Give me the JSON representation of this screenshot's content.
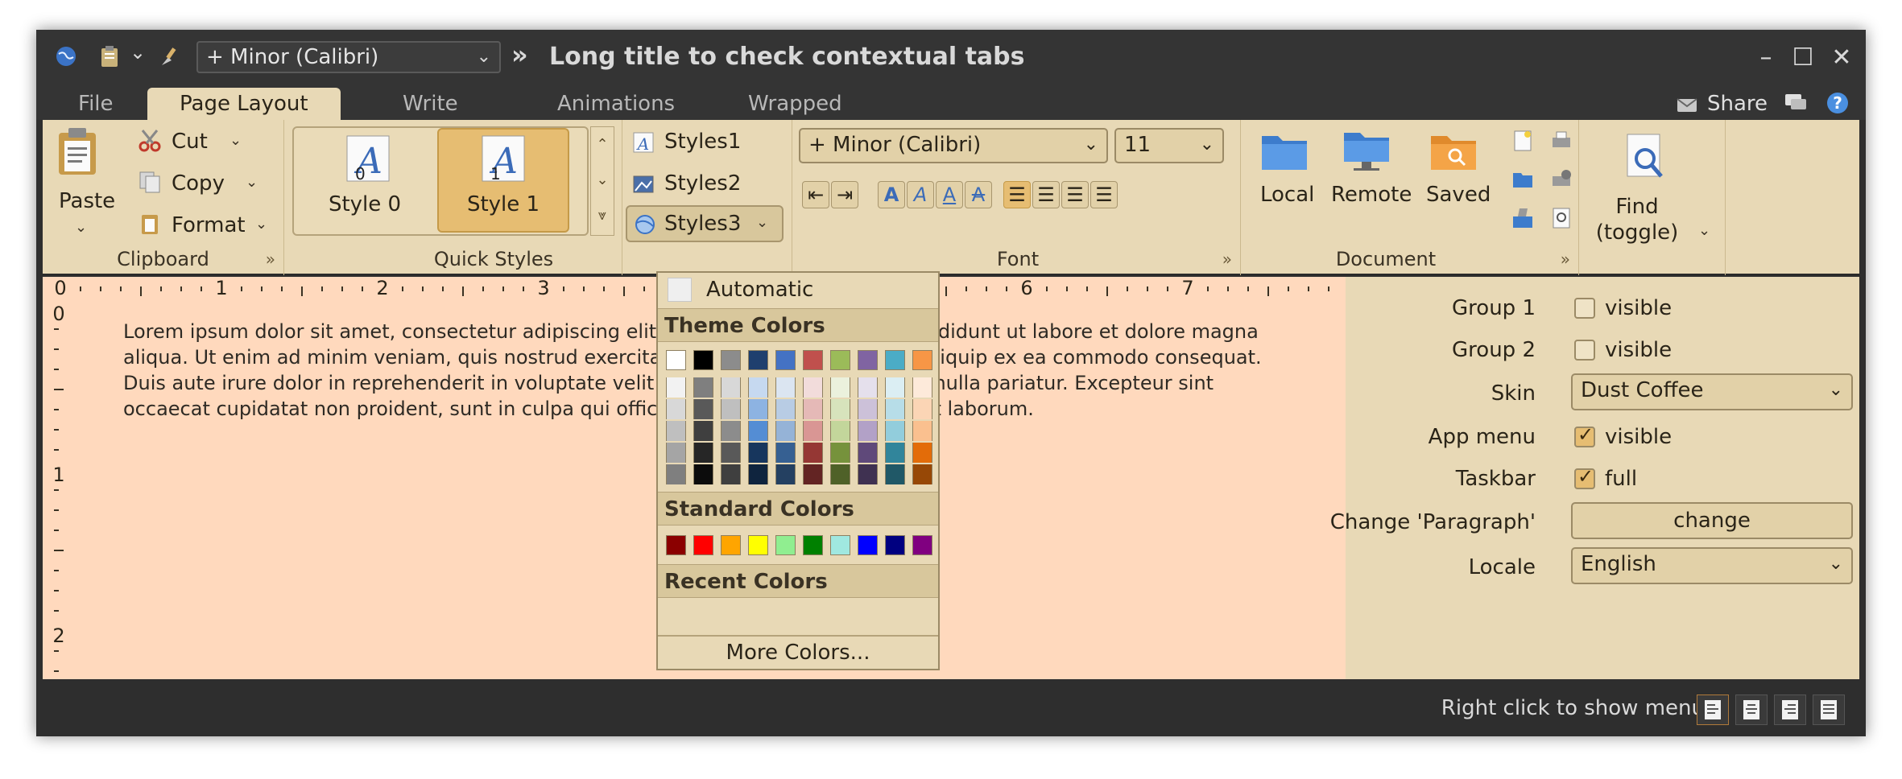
{
  "window": {
    "title": "Long title to check contextual tabs",
    "font_combo": "+ Minor (Calibri)",
    "overflow": "»"
  },
  "tabs": [
    {
      "label": "File"
    },
    {
      "label": "Page Layout"
    },
    {
      "label": "Write"
    },
    {
      "label": "Animations"
    },
    {
      "label": "Wrapped"
    }
  ],
  "share_label": "Share",
  "clipboard": {
    "paste": "Paste",
    "cut": "Cut",
    "copy": "Copy",
    "format": "Format",
    "title": "Clipboard"
  },
  "quick_styles": {
    "style0": "Style 0",
    "style1": "Style 1",
    "title": "Quick Styles"
  },
  "styles": {
    "styles1": "Styles1",
    "styles2": "Styles2",
    "styles3": "Styles3"
  },
  "font": {
    "family": "+ Minor (Calibri)",
    "size": "11",
    "title": "Font"
  },
  "document": {
    "local": "Local",
    "remote": "Remote",
    "saved": "Saved",
    "title": "Document"
  },
  "find": {
    "line1": "Find",
    "line2": "(toggle)"
  },
  "ruler": {
    "h_labels": [
      "0",
      "1",
      "2",
      "3",
      "4",
      "5",
      "6",
      "7"
    ],
    "v_labels": [
      "0",
      "1",
      "2"
    ]
  },
  "lorem": "Lorem ipsum dolor sit amet, consectetur adipiscing elit, sed do eiusmod tempor incididunt ut labore et dolore magna aliqua. Ut enim ad minim veniam, quis nostrud exercitation ullamco laboris nisi ut aliquip ex ea commodo consequat. Duis aute irure dolor in reprehenderit in voluptate velit esse cillum dolore eu fugiat nulla pariatur. Excepteur sint occaecat cupidatat non proident, sunt in culpa qui officia deserunt mollit anim id est laborum.",
  "color_popup": {
    "automatic": "Automatic",
    "theme_title": "Theme Colors",
    "standard_title": "Standard Colors",
    "recent_title": "Recent Colors",
    "more": "More Colors...",
    "theme_top": [
      "#ffffff",
      "#000000",
      "#8c8c8c",
      "#1f3f6e",
      "#4472c4",
      "#c0504d",
      "#9bbb59",
      "#8064a2",
      "#4bacc6",
      "#f79646"
    ],
    "theme_columns": [
      [
        "#f2f2f2",
        "#d8d8d8",
        "#bfbfbf",
        "#a5a5a5",
        "#7f7f7f"
      ],
      [
        "#7f7f7f",
        "#595959",
        "#3f3f3f",
        "#262626",
        "#0c0c0c"
      ],
      [
        "#d8d8d8",
        "#bfbfbf",
        "#8c8c8c",
        "#595959",
        "#3f3f3f"
      ],
      [
        "#c6d9f0",
        "#8db3e2",
        "#548dd4",
        "#17365d",
        "#0f243e"
      ],
      [
        "#dbe5f1",
        "#b8cce4",
        "#95b3d7",
        "#366092",
        "#244061"
      ],
      [
        "#f2dcdb",
        "#e5b9b7",
        "#d99694",
        "#953734",
        "#632423"
      ],
      [
        "#ebf1dd",
        "#d7e3bc",
        "#c3d69b",
        "#76923c",
        "#4f6128"
      ],
      [
        "#e5e0ec",
        "#ccc1d9",
        "#b2a1c7",
        "#5f497a",
        "#3f3151"
      ],
      [
        "#dbeef3",
        "#b7dde8",
        "#92cddc",
        "#31859b",
        "#205867"
      ],
      [
        "#fdeada",
        "#fbd5b5",
        "#fac08f",
        "#e36c09",
        "#974806"
      ]
    ],
    "standard": [
      "#8b0000",
      "#ff0000",
      "#ffa500",
      "#ffff00",
      "#90ee90",
      "#008000",
      "#a0e8e0",
      "#0000ff",
      "#000080",
      "#800080"
    ]
  },
  "side_panel": {
    "group1": "Group 1",
    "group2": "Group 2",
    "skin": "Skin",
    "app_menu": "App menu",
    "taskbar": "Taskbar",
    "change_paragraph": "Change 'Paragraph'",
    "locale": "Locale",
    "visible": "visible",
    "full": "full",
    "skin_value": "Dust Coffee",
    "change_button": "change",
    "locale_value": "English"
  },
  "status": "Right click to show menu"
}
